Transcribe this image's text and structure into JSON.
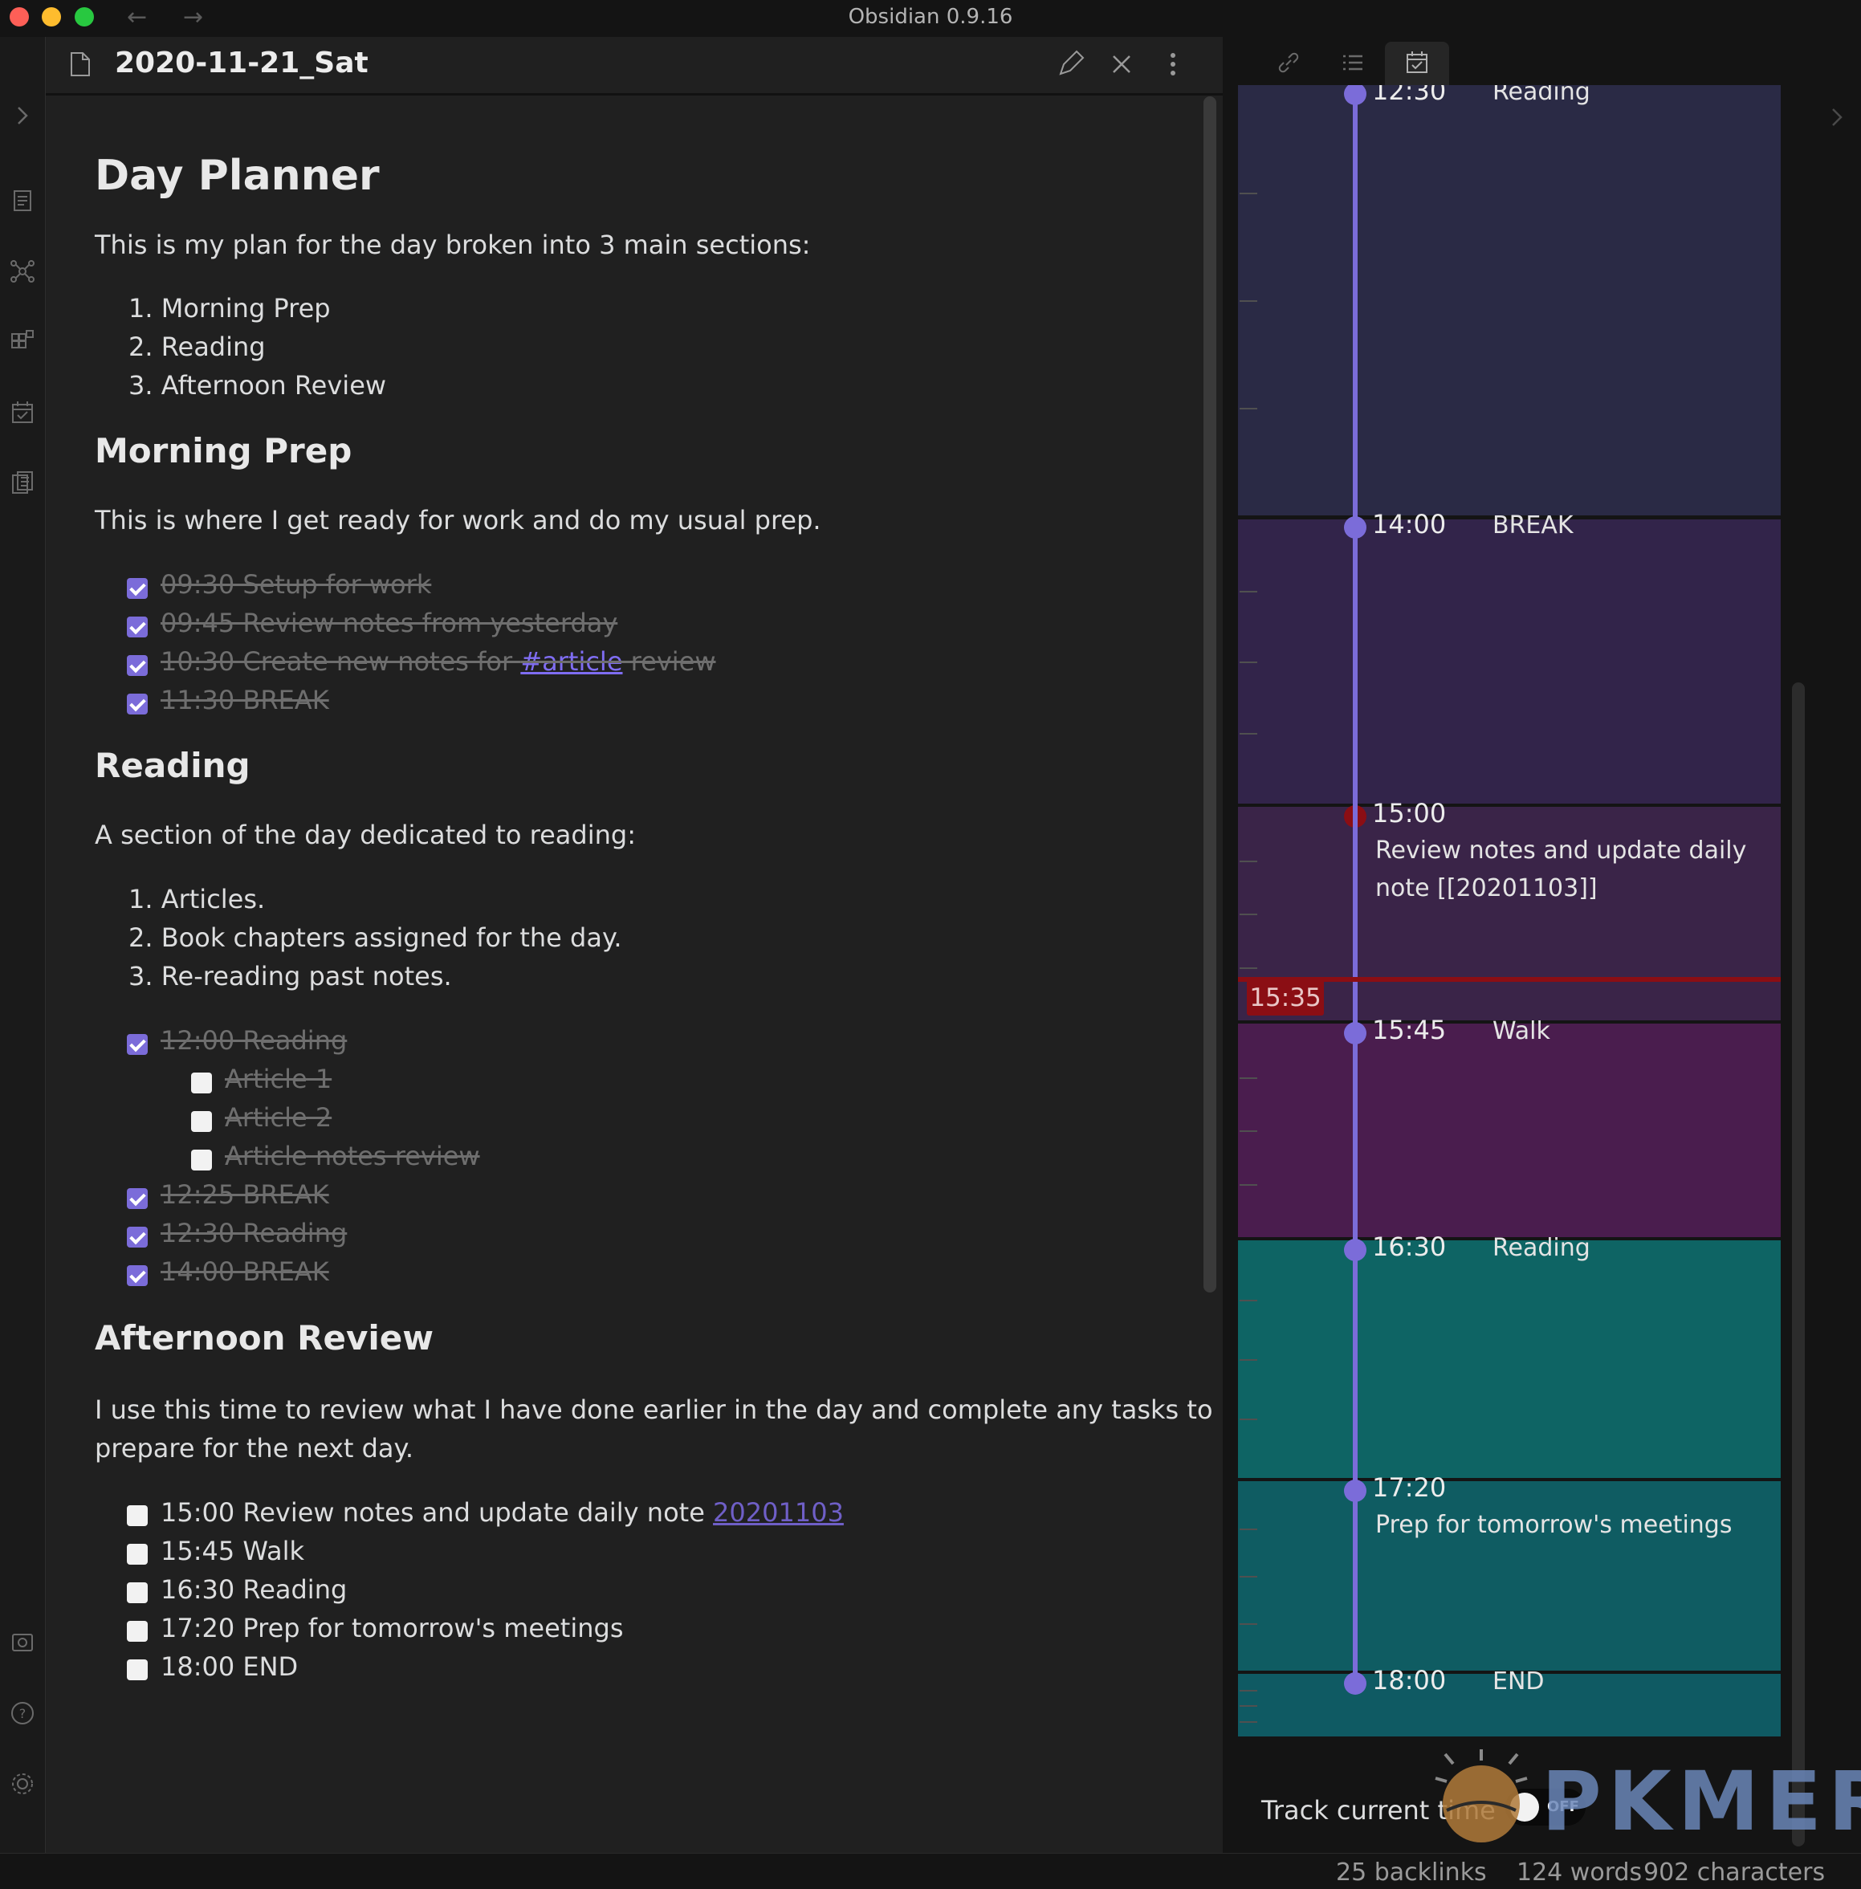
{
  "window": {
    "title": "Obsidian 0.9.16"
  },
  "header": {
    "doc_title": "2020-11-21_Sat"
  },
  "note": {
    "h1": "Day Planner",
    "intro": "This is my plan for the day broken into 3 main sections:",
    "sections_list": [
      "1. Morning Prep",
      "2. Reading",
      "3. Afternoon Review"
    ],
    "morning": {
      "heading": "Morning Prep",
      "text": "This is where I get ready for work and do my usual prep.",
      "tasks": [
        "09:30 Setup for work",
        "09:45 Review notes from yesterday",
        "10:30 Create new notes for ",
        "11:30 BREAK"
      ],
      "tag": "#article",
      "tag_suffix": " review"
    },
    "reading": {
      "heading": "Reading",
      "text": "A section of the day dedicated to reading:",
      "list": [
        "1. Articles.",
        "2. Book chapters assigned for the day.",
        "3. Re-reading past notes."
      ],
      "task_main": "12:00 Reading",
      "subtasks": [
        "Article 1",
        "Article 2",
        "Article notes review"
      ],
      "tasks_after": [
        "12:25 BREAK",
        "12:30 Reading",
        "14:00 BREAK"
      ]
    },
    "afternoon": {
      "heading": "Afternoon Review",
      "text_line1": "I use this time to review what I have done earlier in the day and complete any tasks to",
      "text_line2": "prepare for the next day.",
      "task1_prefix": "15:00 Review notes and update daily note ",
      "task1_link": "20201103",
      "tasks": [
        "15:45 Walk",
        "16:30 Reading",
        "17:20 Prep for tomorrow's meetings",
        "18:00 END"
      ]
    }
  },
  "timeline": {
    "blocks": [
      {
        "time": "12:30",
        "label": "Reading",
        "color": "#2a2a45"
      },
      {
        "time": "14:00",
        "label": "BREAK",
        "color": "#32244a"
      },
      {
        "time": "15:00",
        "label": "Review notes and update daily",
        "label2": "note [[20201103]]",
        "color": "#3a2448"
      },
      {
        "time": "15:45",
        "label": "Walk",
        "color": "#4a1d4e"
      },
      {
        "time": "16:30",
        "label": "Reading",
        "color": "#0e6464"
      },
      {
        "time": "17:20",
        "label": "Prep for tomorrow's meetings",
        "color": "#0f5c62"
      },
      {
        "time": "18:00",
        "label": "END",
        "color": "#0f5a63"
      }
    ],
    "current_time": "15:35",
    "accent_color": "#7b6cd9",
    "now_color": "#8b0e14"
  },
  "track": {
    "label": "Track current time",
    "toggle": "OFF"
  },
  "status": {
    "backlinks": "25 backlinks",
    "words": "124 words",
    "chars": "902 characters"
  },
  "watermark": {
    "text": "PKMER"
  }
}
